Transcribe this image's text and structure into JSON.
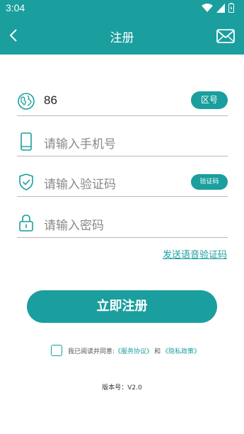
{
  "status_bar": {
    "time": "3:04"
  },
  "nav": {
    "title": "注册"
  },
  "form": {
    "country_code_value": "86",
    "area_code_button": "区号",
    "phone_placeholder": "请输入手机号",
    "code_placeholder": "请输入验证码",
    "get_code_button": "验证码",
    "password_placeholder": "请输入密码",
    "voice_code_link": "发送语音验证码"
  },
  "register_button": "立即注册",
  "agreement": {
    "prefix": "我已阅读并同意:",
    "service_link": "《服务协议》",
    "and": "和",
    "privacy_link": "《隐私政策》"
  },
  "version_text": "版本号：V2.0",
  "colors": {
    "accent": "#1a9e9e"
  }
}
